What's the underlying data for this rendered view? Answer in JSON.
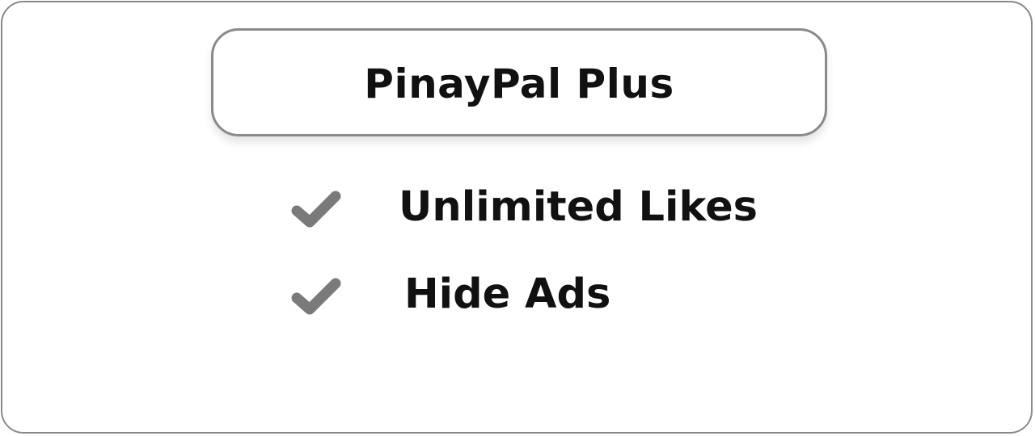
{
  "plan": {
    "title": "PinayPal Plus"
  },
  "features": [
    {
      "icon": "check-icon",
      "label": "Unlimited Likes"
    },
    {
      "icon": "check-icon",
      "label": "Hide Ads"
    }
  ],
  "colors": {
    "border": "#8a8a8a",
    "check": "#7a7a7a",
    "text": "#111111",
    "background": "#ffffff"
  }
}
